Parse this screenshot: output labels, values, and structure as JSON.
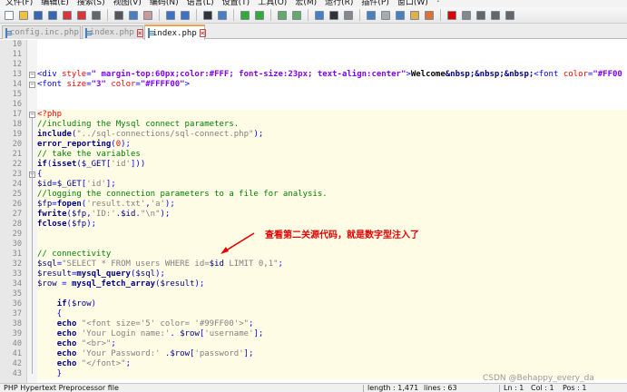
{
  "menu": {
    "items": [
      "文件(F)",
      "编辑(E)",
      "搜索(S)",
      "视图(V)",
      "编码(N)",
      "语言(L)",
      "设置(T)",
      "工具(O)",
      "宏(M)",
      "运行(R)",
      "插件(P)",
      "窗口(W)",
      "?"
    ]
  },
  "toolbar": {
    "icons": [
      "new-file-icon",
      "open-file-icon",
      "save-icon",
      "save-all-icon",
      "close-icon",
      "close-all-icon",
      "print-icon",
      "cut-icon",
      "copy-icon",
      "paste-icon",
      "undo-icon",
      "redo-icon",
      "find-icon",
      "replace-icon",
      "zoom-in-icon",
      "zoom-out-icon",
      "sync-vertical-icon",
      "sync-horizontal-icon",
      "word-wrap-icon",
      "show-all-chars-icon",
      "indent-guide-icon",
      "user-language-icon",
      "doc-map-icon",
      "function-list-icon",
      "folder-workspace-icon",
      "monitor-icon",
      "record-macro-icon",
      "stop-record-icon",
      "play-macro-icon",
      "play-multiple-icon",
      "save-macro-icon"
    ]
  },
  "tabs": [
    {
      "label": "config.inc.php",
      "active": false
    },
    {
      "label": "index.php",
      "active": false
    },
    {
      "label": "index.php",
      "active": true
    }
  ],
  "editor": {
    "lines": [
      {
        "n": "10",
        "segs": []
      },
      {
        "n": "11",
        "segs": []
      },
      {
        "n": "12",
        "segs": []
      },
      {
        "n": "13",
        "segs": [
          [
            "ht",
            "<div "
          ],
          [
            "at",
            "style"
          ],
          [
            "ht",
            "="
          ],
          [
            "av",
            "\" margin-top:60px;color:#FFF; font-size:23px; text-align:center\""
          ],
          [
            "ht",
            ">"
          ],
          [
            "tx",
            "Welcome"
          ],
          [
            "en",
            "&nbsp;&nbsp;&nbsp;"
          ],
          [
            "ht",
            "<font "
          ],
          [
            "at",
            "color"
          ],
          [
            "ht",
            "="
          ],
          [
            "av",
            "\"#FF00"
          ]
        ]
      },
      {
        "n": "14",
        "segs": [
          [
            "ht",
            "<font "
          ],
          [
            "at",
            "size"
          ],
          [
            "ht",
            "="
          ],
          [
            "av",
            "\"3\" "
          ],
          [
            "at",
            "color"
          ],
          [
            "ht",
            "="
          ],
          [
            "av",
            "\"#FFFF00\""
          ],
          [
            "ht",
            ">"
          ]
        ]
      },
      {
        "n": "15",
        "segs": []
      },
      {
        "n": "16",
        "segs": []
      },
      {
        "n": "17",
        "segs": [
          [
            "pt",
            "<?php"
          ]
        ]
      },
      {
        "n": "18",
        "segs": [
          [
            "cm",
            "//including the Mysql connect parameters."
          ]
        ]
      },
      {
        "n": "19",
        "segs": [
          [
            "k",
            "include"
          ],
          [
            "bl",
            "("
          ],
          [
            "st",
            "\"../sql-connections/sql-connect.php\""
          ],
          [
            "bl",
            ");"
          ]
        ]
      },
      {
        "n": "20",
        "segs": [
          [
            "k",
            "error_reporting"
          ],
          [
            "bl",
            "("
          ],
          [
            "nm",
            "0"
          ],
          [
            "bl",
            ");"
          ]
        ]
      },
      {
        "n": "21",
        "segs": [
          [
            "cm",
            "// take the variables"
          ]
        ]
      },
      {
        "n": "22",
        "segs": [
          [
            "k",
            "if"
          ],
          [
            "bl",
            "("
          ],
          [
            "k",
            "isset"
          ],
          [
            "bl",
            "("
          ],
          [
            "vr",
            "$_GET"
          ],
          [
            "bl",
            "["
          ],
          [
            "st",
            "'id'"
          ],
          [
            "bl",
            "]))"
          ]
        ]
      },
      {
        "n": "23",
        "segs": [
          [
            "bl",
            "{"
          ]
        ]
      },
      {
        "n": "24",
        "segs": [
          [
            "vr",
            "$id"
          ],
          [
            "bl",
            "="
          ],
          [
            "vr",
            "$_GET"
          ],
          [
            "bl",
            "["
          ],
          [
            "st",
            "'id'"
          ],
          [
            "bl",
            "];"
          ]
        ]
      },
      {
        "n": "25",
        "segs": [
          [
            "cm",
            "//logging the connection parameters to a file for analysis."
          ]
        ]
      },
      {
        "n": "26",
        "segs": [
          [
            "vr",
            "$fp"
          ],
          [
            "bl",
            "="
          ],
          [
            "k",
            "fopen"
          ],
          [
            "bl",
            "("
          ],
          [
            "st",
            "'result.txt'"
          ],
          [
            "bl",
            ","
          ],
          [
            "st",
            "'a'"
          ],
          [
            "bl",
            ");"
          ]
        ]
      },
      {
        "n": "27",
        "segs": [
          [
            "k",
            "fwrite"
          ],
          [
            "bl",
            "("
          ],
          [
            "vr",
            "$fp"
          ],
          [
            "bl",
            ","
          ],
          [
            "st",
            "'ID:'"
          ],
          [
            "bl",
            "."
          ],
          [
            "vr",
            "$id"
          ],
          [
            "bl",
            "."
          ],
          [
            "st",
            "\"\\n\""
          ],
          [
            "bl",
            ");"
          ]
        ]
      },
      {
        "n": "28",
        "segs": [
          [
            "k",
            "fclose"
          ],
          [
            "bl",
            "("
          ],
          [
            "vr",
            "$fp"
          ],
          [
            "bl",
            ");"
          ]
        ]
      },
      {
        "n": "29",
        "segs": []
      },
      {
        "n": "30",
        "segs": []
      },
      {
        "n": "31",
        "segs": [
          [
            "cm",
            "// connectivity"
          ]
        ]
      },
      {
        "n": "32",
        "segs": [
          [
            "vr",
            "$sql"
          ],
          [
            "bl",
            "="
          ],
          [
            "st",
            "\"SELECT * FROM users WHERE id="
          ],
          [
            "vr",
            "$id"
          ],
          [
            "st",
            " LIMIT 0,1\""
          ],
          [
            "bl",
            ";"
          ]
        ]
      },
      {
        "n": "33",
        "segs": [
          [
            "vr",
            "$result"
          ],
          [
            "bl",
            "="
          ],
          [
            "k",
            "mysql_query"
          ],
          [
            "bl",
            "("
          ],
          [
            "vr",
            "$sql"
          ],
          [
            "bl",
            ");"
          ]
        ]
      },
      {
        "n": "34",
        "segs": [
          [
            "vr",
            "$row"
          ],
          [
            "bl",
            " = "
          ],
          [
            "k",
            "mysql_fetch_array"
          ],
          [
            "bl",
            "("
          ],
          [
            "vr",
            "$result"
          ],
          [
            "bl",
            ");"
          ]
        ]
      },
      {
        "n": "35",
        "segs": []
      },
      {
        "n": "36",
        "segs": [
          [
            "bl",
            "    "
          ],
          [
            "k",
            "if"
          ],
          [
            "bl",
            "("
          ],
          [
            "vr",
            "$row"
          ],
          [
            "bl",
            ")"
          ]
        ]
      },
      {
        "n": "37",
        "segs": [
          [
            "bl",
            "    {"
          ]
        ]
      },
      {
        "n": "38",
        "segs": [
          [
            "bl",
            "    "
          ],
          [
            "k",
            "echo"
          ],
          [
            "bl",
            " "
          ],
          [
            "st",
            "\"<font size='5' color= '#99FF00'>\""
          ],
          [
            "bl",
            ";"
          ]
        ]
      },
      {
        "n": "39",
        "segs": [
          [
            "bl",
            "    "
          ],
          [
            "k",
            "echo"
          ],
          [
            "bl",
            " "
          ],
          [
            "st",
            "'Your Login name:'"
          ],
          [
            "bl",
            ". "
          ],
          [
            "vr",
            "$row"
          ],
          [
            "bl",
            "["
          ],
          [
            "st",
            "'username'"
          ],
          [
            "bl",
            "];"
          ]
        ]
      },
      {
        "n": "40",
        "segs": [
          [
            "bl",
            "    "
          ],
          [
            "k",
            "echo"
          ],
          [
            "bl",
            " "
          ],
          [
            "st",
            "\"<br>\""
          ],
          [
            "bl",
            ";"
          ]
        ]
      },
      {
        "n": "41",
        "segs": [
          [
            "bl",
            "    "
          ],
          [
            "k",
            "echo"
          ],
          [
            "bl",
            " "
          ],
          [
            "st",
            "'Your Password:'"
          ],
          [
            "bl",
            " ."
          ],
          [
            "vr",
            "$row"
          ],
          [
            "bl",
            "["
          ],
          [
            "st",
            "'password'"
          ],
          [
            "bl",
            "];"
          ]
        ]
      },
      {
        "n": "42",
        "segs": [
          [
            "bl",
            "    "
          ],
          [
            "k",
            "echo"
          ],
          [
            "bl",
            " "
          ],
          [
            "st",
            "\"</font>\""
          ],
          [
            "bl",
            ";"
          ]
        ]
      },
      {
        "n": "43",
        "segs": [
          [
            "bl",
            "    }"
          ]
        ]
      }
    ]
  },
  "annotation": {
    "text": "查看第二关源代码，就是数字型注入了",
    "color": "#e00000"
  },
  "status": {
    "lang": "PHP Hypertext Preprocessor file",
    "length": "length : 1,471",
    "lines": "lines : 63",
    "ln": "Ln : 1",
    "col": "Col : 1",
    "pos": "Pos : 1"
  },
  "watermark": "CSDN @Behappy_every_da"
}
